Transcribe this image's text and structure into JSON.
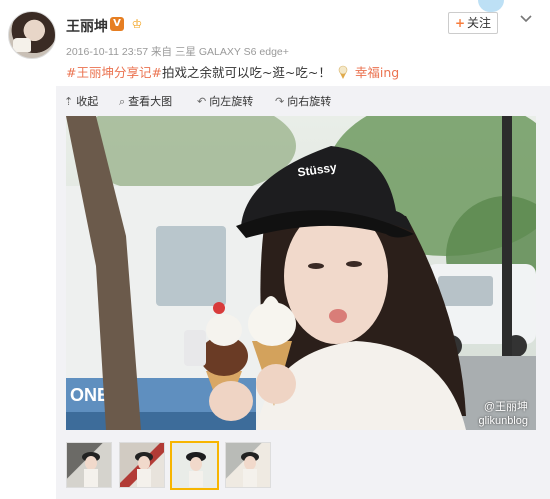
{
  "post": {
    "username": "王丽坤",
    "verified_badge": "V",
    "vip_badge": "♔",
    "follow_label": "关注",
    "follow_plus": "+",
    "meta": "2016-10-11 23:57 来自 三星 GALAXY S6 edge+",
    "topic": "#王丽坤分享记#",
    "text": "拍戏之余就可以吃~逛~吃~！",
    "mood_link": "幸福ing"
  },
  "toolbar": {
    "collapse": "收起",
    "view_large": "查看大图",
    "rotate_left": "向左旋转",
    "rotate_right": "向右旋转",
    "collapse_icon": "⇡",
    "view_icon": "⌕",
    "rotate_left_icon": "↶",
    "rotate_right_icon": "↷"
  },
  "photo": {
    "cap_text": "Stüssy",
    "watermark_user": "@王丽坤",
    "watermark_site": "glikunblog"
  },
  "colors": {
    "accent_link": "#eb7350",
    "active_thumb_border": "#f7b500"
  },
  "icons": {
    "chevron": "chevron-down-icon",
    "collapse": "collapse-icon",
    "search": "search-icon",
    "rotate_left": "rotate-left-icon",
    "rotate_right": "rotate-right-icon"
  }
}
